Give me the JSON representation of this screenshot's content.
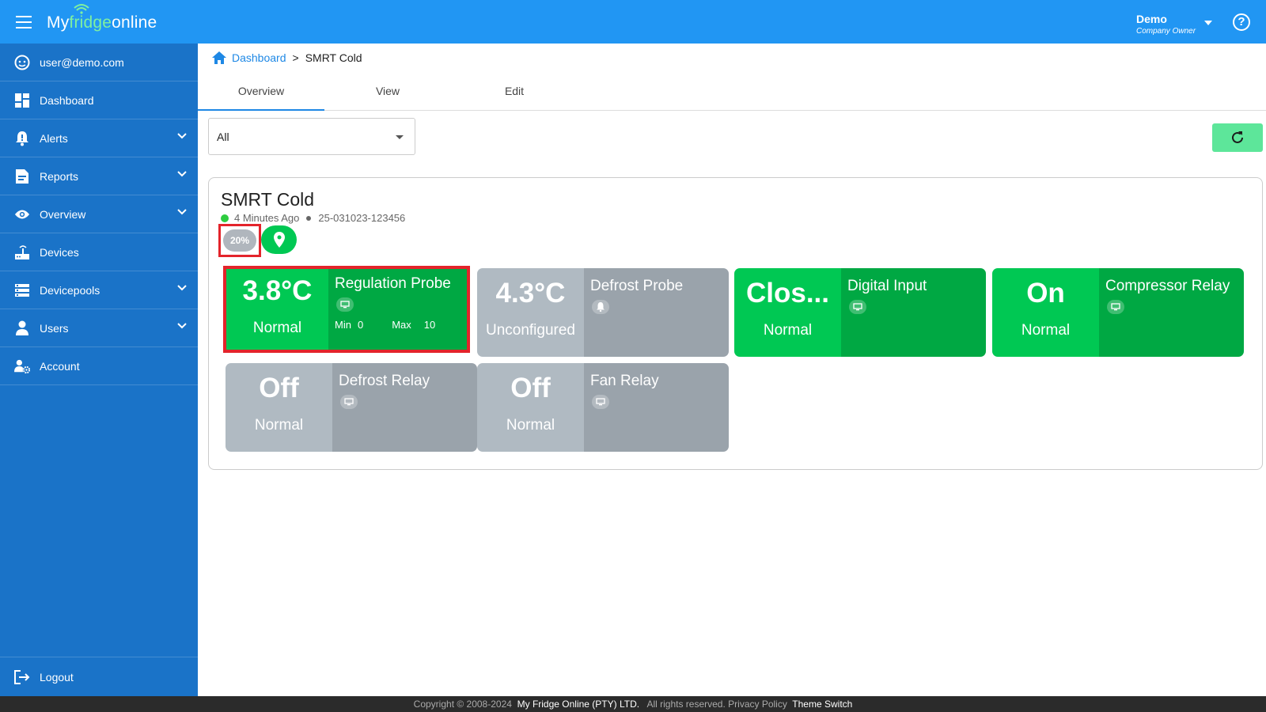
{
  "header": {
    "logo_prefix": "My",
    "logo_accent": "fridge",
    "logo_suffix": "online",
    "user_name": "Demo",
    "user_role": "Company Owner",
    "help_glyph": "?",
    "icons": {
      "menu": "hamburger-icon",
      "help": "help-circle-icon",
      "user_menu": "caret-down-icon"
    }
  },
  "sidebar": {
    "items": [
      {
        "label": "user@demo.com",
        "icon": "face-icon",
        "expandable": false
      },
      {
        "label": "Dashboard",
        "icon": "dashboard-icon",
        "expandable": false
      },
      {
        "label": "Alerts",
        "icon": "bell-alert-icon",
        "expandable": true
      },
      {
        "label": "Reports",
        "icon": "report-icon",
        "expandable": true
      },
      {
        "label": "Overview",
        "icon": "eye-icon",
        "expandable": true
      },
      {
        "label": "Devices",
        "icon": "router-icon",
        "expandable": false
      },
      {
        "label": "Devicepools",
        "icon": "storage-icon",
        "expandable": true
      },
      {
        "label": "Users",
        "icon": "person-icon",
        "expandable": true
      },
      {
        "label": "Account",
        "icon": "account-settings-icon",
        "expandable": false
      }
    ],
    "logout_label": "Logout"
  },
  "breadcrumb": {
    "home_label": "Dashboard",
    "current": "SMRT Cold",
    "separator": ">"
  },
  "tabs": [
    {
      "label": "Overview",
      "active": true
    },
    {
      "label": "View",
      "active": false
    },
    {
      "label": "Edit",
      "active": false
    }
  ],
  "filter": {
    "selected": "All"
  },
  "device": {
    "name": "SMRT Cold",
    "last_seen": "4 Minutes Ago",
    "serial": "25-031023-123456",
    "battery": "20%",
    "status_color": "#2ecc40"
  },
  "sensors": [
    {
      "value": "3.8°C",
      "status": "Normal",
      "name": "Regulation Probe",
      "icon": "monitor-icon",
      "state": "green",
      "min_label": "Min",
      "min": "0",
      "max_label": "Max",
      "max": "10",
      "highlight": true
    },
    {
      "value": "4.3°C",
      "status": "Unconfigured",
      "name": "Defrost Probe",
      "icon": "bell-icon",
      "state": "grey"
    },
    {
      "value": "Clos...",
      "status": "Normal",
      "name": "Digital Input",
      "icon": "monitor-icon",
      "state": "green"
    },
    {
      "value": "On",
      "status": "Normal",
      "name": "Compressor Relay",
      "icon": "monitor-icon",
      "state": "green"
    },
    {
      "value": "Off",
      "status": "Normal",
      "name": "Defrost Relay",
      "icon": "monitor-icon",
      "state": "grey"
    },
    {
      "value": "Off",
      "status": "Normal",
      "name": "Fan Relay",
      "icon": "monitor-icon",
      "state": "grey"
    }
  ],
  "footer": {
    "copyright": "Copyright © 2008-2024",
    "company": "My Fridge Online (PTY) LTD.",
    "rights": "All rights reserved.",
    "privacy": "Privacy Policy",
    "theme": "Theme Switch"
  },
  "colors": {
    "topbar": "#2196f3",
    "sidebar": "#1a73c8",
    "ok_green": "#00c853",
    "ok_green_dark": "#00a843",
    "inactive_grey": "#b0bac2",
    "highlight_red": "#e3242b",
    "refresh_button": "#5de69a"
  }
}
